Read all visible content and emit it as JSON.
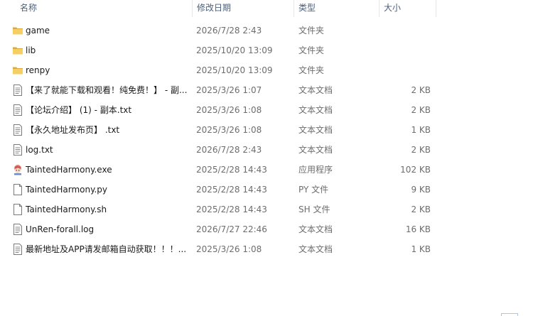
{
  "columns": {
    "name": "名称",
    "date": "修改日期",
    "type": "类型",
    "size": "大小"
  },
  "files": [
    {
      "icon": "folder-icon",
      "name": "game",
      "date": "2026/7/28 2:43",
      "type": "文件夹",
      "size": ""
    },
    {
      "icon": "folder-icon",
      "name": "lib",
      "date": "2025/10/20 13:09",
      "type": "文件夹",
      "size": ""
    },
    {
      "icon": "folder-icon",
      "name": "renpy",
      "date": "2025/10/20 13:09",
      "type": "文件夹",
      "size": ""
    },
    {
      "icon": "text-document-icon",
      "name": "【来了就能下载和观看！纯免费！】 - 副...",
      "date": "2025/3/26 1:07",
      "type": "文本文档",
      "size": "2 KB"
    },
    {
      "icon": "text-document-icon",
      "name": "【论坛介绍】 (1) - 副本.txt",
      "date": "2025/3/26 1:08",
      "type": "文本文档",
      "size": "2 KB"
    },
    {
      "icon": "text-document-icon",
      "name": "【永久地址发布页】 .txt",
      "date": "2025/3/26 1:08",
      "type": "文本文档",
      "size": "1 KB"
    },
    {
      "icon": "text-document-icon",
      "name": "log.txt",
      "date": "2026/7/28 2:43",
      "type": "文本文档",
      "size": "2 KB"
    },
    {
      "icon": "application-icon",
      "name": "TaintedHarmony.exe",
      "date": "2025/2/28 14:43",
      "type": "应用程序",
      "size": "102 KB"
    },
    {
      "icon": "blank-file-icon",
      "name": "TaintedHarmony.py",
      "date": "2025/2/28 14:43",
      "type": "PY 文件",
      "size": "9 KB"
    },
    {
      "icon": "blank-file-icon",
      "name": "TaintedHarmony.sh",
      "date": "2025/2/28 14:43",
      "type": "SH 文件",
      "size": "2 KB"
    },
    {
      "icon": "text-document-icon",
      "name": "UnRen-forall.log",
      "date": "2026/7/27 22:46",
      "type": "文本文档",
      "size": "16 KB"
    },
    {
      "icon": "text-document-icon",
      "name": "最新地址及APP请发邮箱自动获取！！！...",
      "date": "2025/3/26 1:08",
      "type": "文本文档",
      "size": "1 KB"
    }
  ],
  "colors": {
    "header_text": "#4c607a",
    "folder": "#f4c95d",
    "muted_text": "#6d6d6d"
  }
}
